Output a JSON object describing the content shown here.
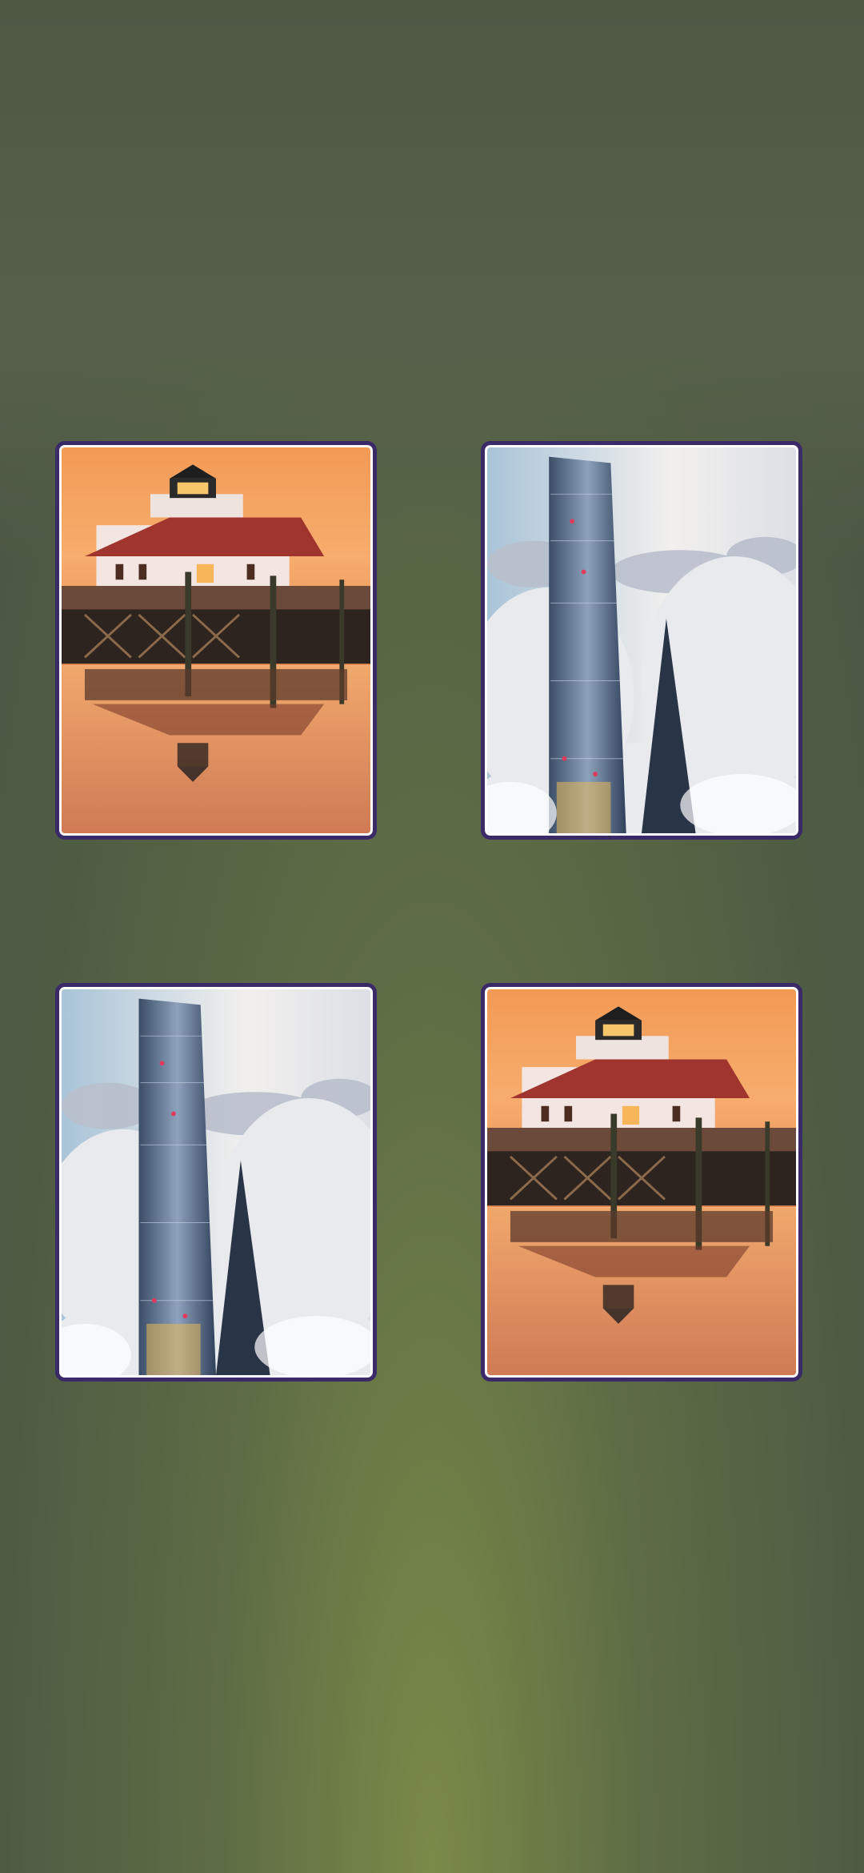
{
  "screen": {
    "background_colors": [
      "#4b5544",
      "#5e6c45",
      "#7a8a48"
    ]
  },
  "tiles": [
    {
      "subject": "lighthouse-on-pier-at-sunset",
      "frame_color": "#3a2a68"
    },
    {
      "subject": "skyscraper-above-clouds",
      "frame_color": "#3a2a68"
    },
    {
      "subject": "skyscraper-above-clouds",
      "frame_color": "#3a2a68"
    },
    {
      "subject": "lighthouse-on-pier-at-sunset",
      "frame_color": "#3a2a68"
    }
  ]
}
